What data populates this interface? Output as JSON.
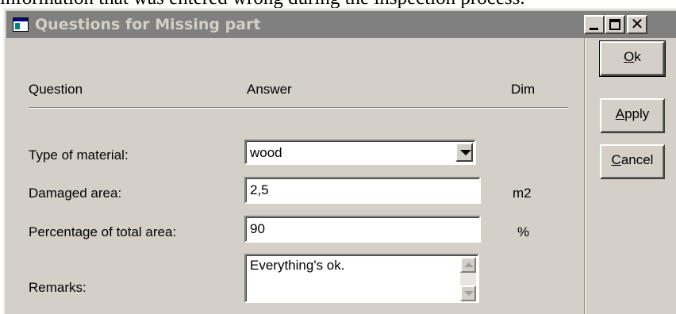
{
  "document": {
    "text_above": "information that was entered wrong during the inspection process."
  },
  "window": {
    "title": "Questions for Missing part",
    "caption_buttons": {
      "minimize": "minimize-icon",
      "maximize": "maximize-icon",
      "close": "close-icon"
    }
  },
  "table": {
    "headers": {
      "question": "Question",
      "answer": "Answer",
      "dim": "Dim"
    },
    "rows": [
      {
        "question": "Type of material:",
        "answer": "wood",
        "dim": "",
        "control": "dropdown"
      },
      {
        "question": "Damaged area:",
        "answer": "2,5",
        "dim": "m2",
        "control": "text"
      },
      {
        "question": "Percentage of total area:",
        "answer": "90",
        "dim": "%",
        "control": "text"
      },
      {
        "question": "Remarks:",
        "answer": "Everything's ok.",
        "dim": "",
        "control": "multiline"
      }
    ]
  },
  "buttons": {
    "ok": {
      "accel": "O",
      "rest": "k"
    },
    "apply": {
      "accel": "A",
      "rest": "pply"
    },
    "cancel": {
      "accel": "C",
      "rest": "ancel"
    }
  },
  "colors": {
    "titlebar_inactive": "#808080",
    "title_text": "#d4d0c8",
    "dialog_face": "#d4d0c8",
    "field_background": "#ffffff"
  }
}
